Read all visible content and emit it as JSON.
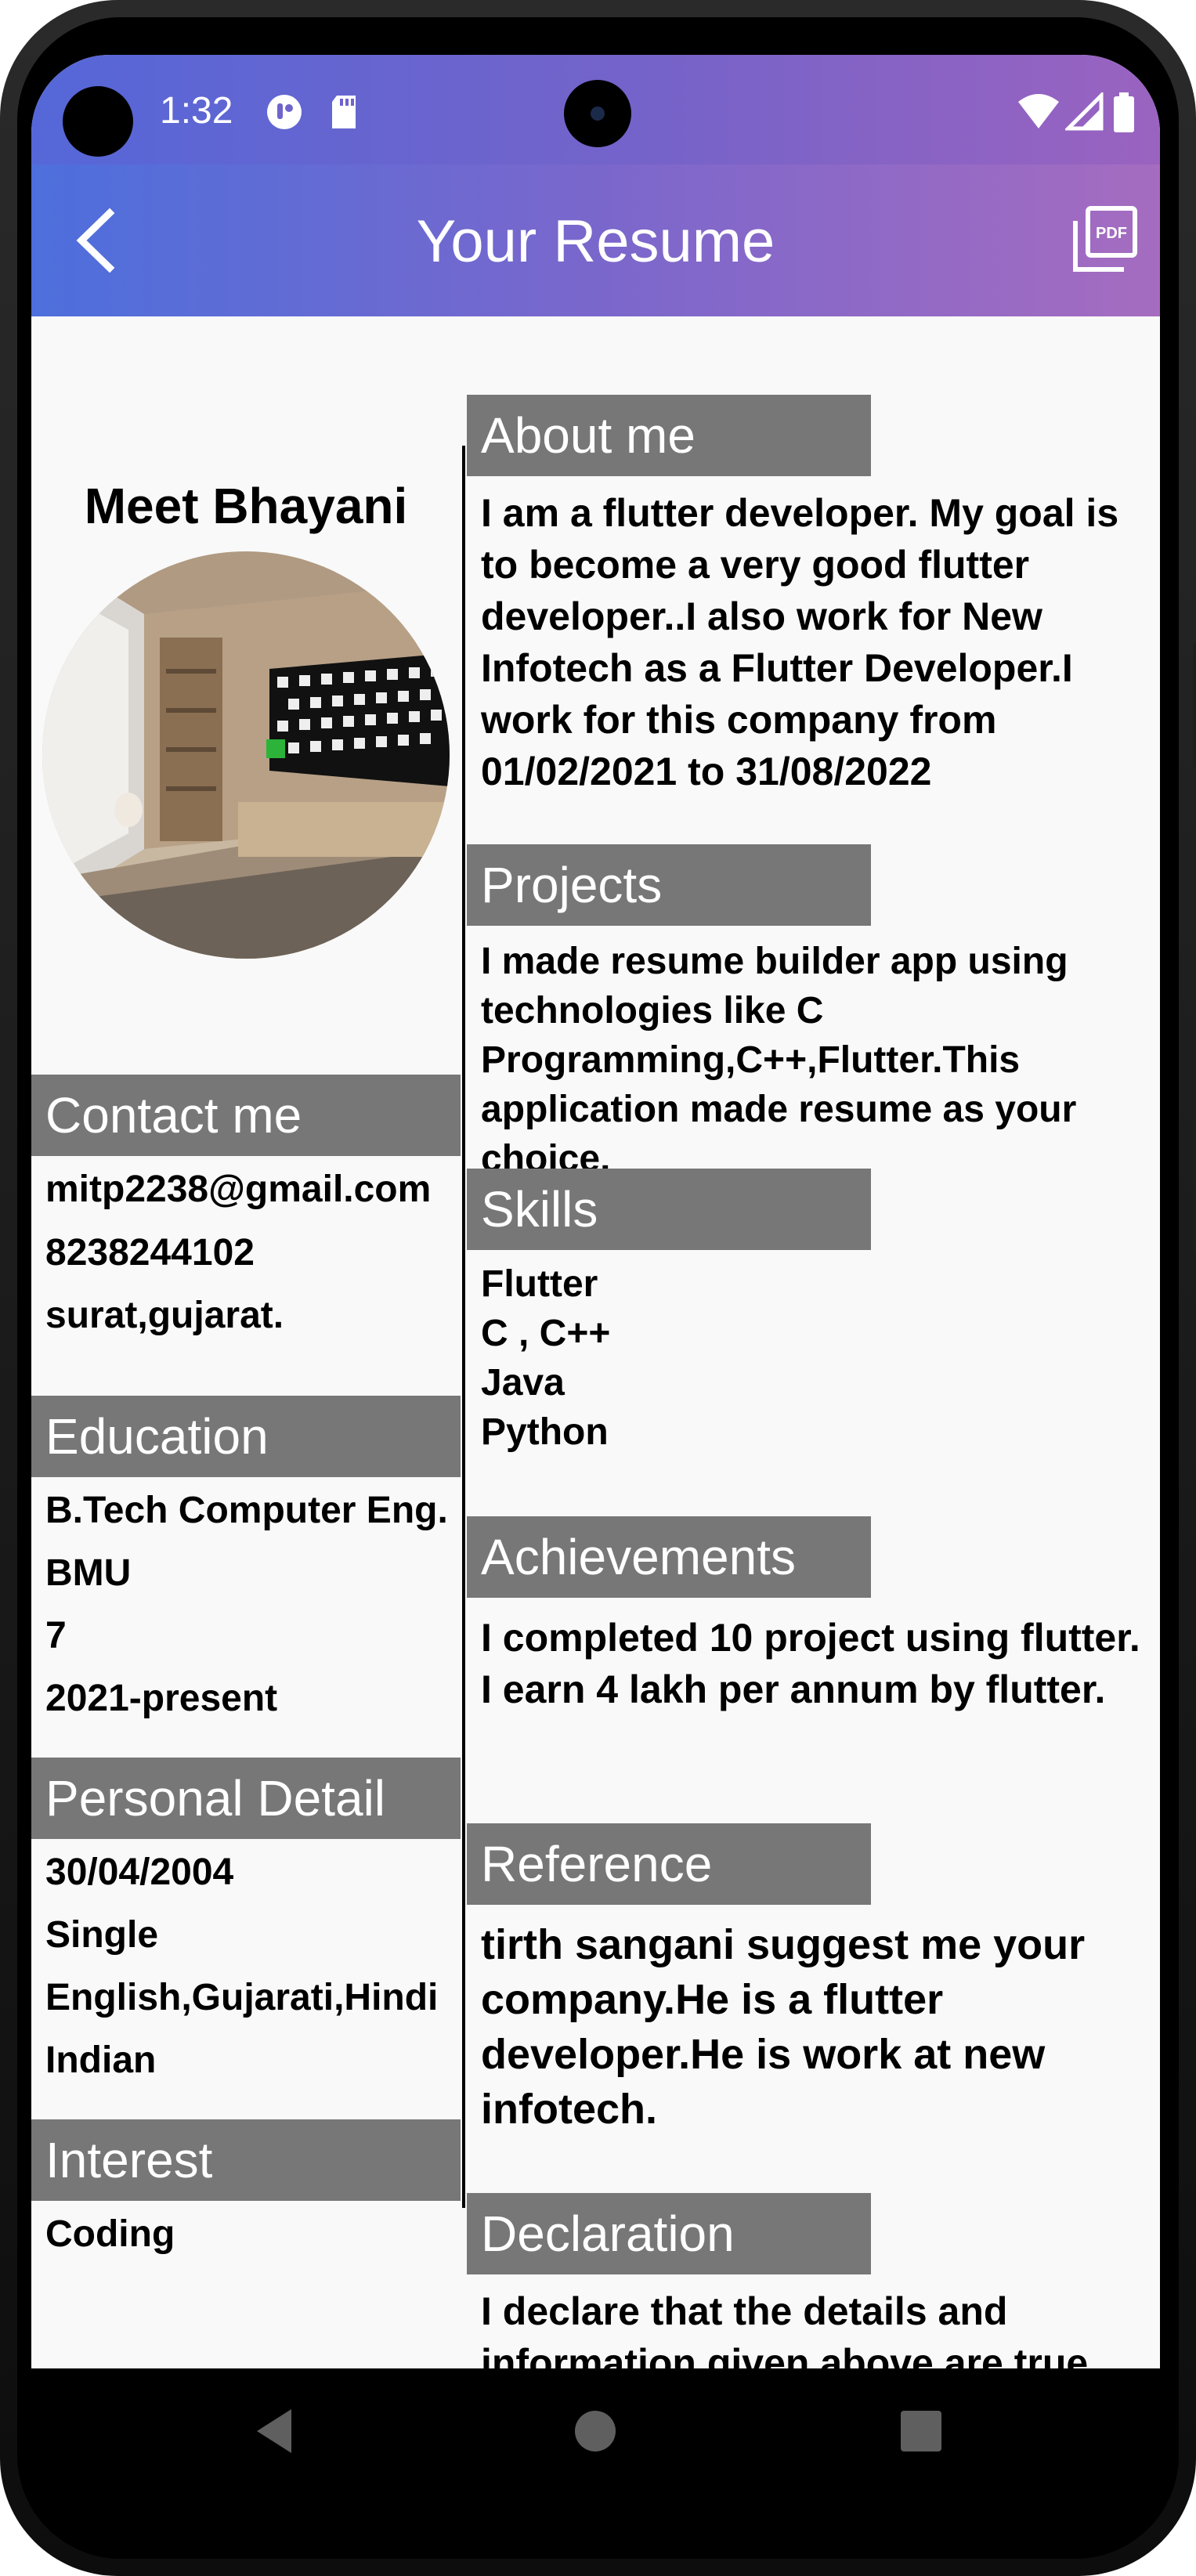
{
  "status_bar": {
    "time": "1:32"
  },
  "app_bar": {
    "title": "Your Resume",
    "back_icon": "back-arrow-icon",
    "pdf_icon": "pdf-icon"
  },
  "profile": {
    "name": "Meet Bhayani"
  },
  "contact": {
    "heading": "Contact me",
    "email": "mitp2238@gmail.com",
    "phone": "8238244102",
    "address": "surat,gujarat."
  },
  "education": {
    "heading": "Education",
    "course": "B.Tech Computer Eng.",
    "school": "BMU",
    "grade": "7",
    "years": "2021-present"
  },
  "personal": {
    "heading": "Personal Detail",
    "dob": "30/04/2004",
    "marital": "Single",
    "languages": "English,Gujarati,Hindi",
    "nationality": "Indian"
  },
  "interest": {
    "heading": "Interest",
    "value": "Coding"
  },
  "about": {
    "heading": "About me",
    "text": "I am a flutter developer. My goal is to become a very good flutter developer..I also work for New Infotech as a Flutter Developer.I work for this company from 01/02/2021 to 31/08/2022"
  },
  "projects": {
    "heading": "Projects",
    "text": "I made resume builder app using technologies like C Programming,C++,Flutter.This application made resume as your choice."
  },
  "skills": {
    "heading": "Skills",
    "items": [
      "Flutter",
      "C , C++",
      "Java",
      "Python"
    ]
  },
  "achievements": {
    "heading": "Achievements",
    "line1": "I completed 10 project using flutter.",
    "line2": "I earn 4 lakh per annum by flutter."
  },
  "reference": {
    "heading": "Reference",
    "text": "tirth sangani suggest me your company.He is a flutter developer.He is work at new infotech."
  },
  "declaration": {
    "heading": "Declaration",
    "text": "I declare that the details and information given above are true."
  },
  "colors": {
    "app_bar_start": "#4d6fdc",
    "app_bar_end": "#a56cc0",
    "section_header": "#777777",
    "background": "#f9f9f9"
  }
}
